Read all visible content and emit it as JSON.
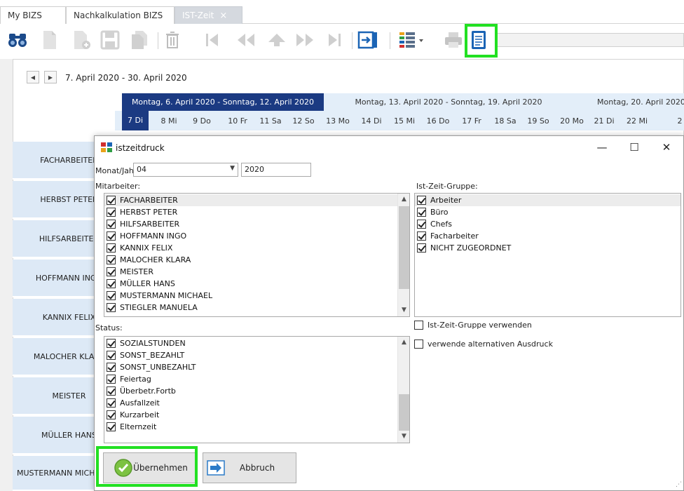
{
  "tabs": [
    {
      "label": "My BIZS"
    },
    {
      "label": "Nachkalkulation BIZS"
    },
    {
      "label": "IST-Zeit",
      "close": "×"
    }
  ],
  "toolbar": {
    "icons": [
      "binoculars-icon",
      "new-document-icon",
      "add-document-icon",
      "save-icon",
      "copy-document-icon",
      "delete-icon",
      "first-record-icon",
      "previous-record-icon",
      "up-icon",
      "next-record-icon",
      "last-record-icon",
      "exit-icon",
      "list-view-icon",
      "print-icon",
      "report-icon"
    ]
  },
  "calendar": {
    "prev": "◀",
    "next": "▶",
    "date_range": "7. April 2020 - 30. April 2020",
    "weeks": [
      "Montag, 6. April 2020 - Sonntag, 12. April 2020",
      "Montag, 13. April 2020 - Sonntag, 19. April 2020",
      "Montag, 20. April 2020"
    ],
    "days": [
      "7 Di",
      "8 Mi",
      "9 Do",
      "10 Fr",
      "11 Sa",
      "12 So",
      "13 Mo",
      "14 Di",
      "15 Mi",
      "16 Do",
      "17 Fr",
      "18 Sa",
      "19 So",
      "20 Mo",
      "21 Di",
      "22 Mi",
      "2"
    ],
    "employees": [
      "FACHARBEITER",
      "HERBST PETER",
      "HILFSARBEITER",
      "HOFFMANN INGO",
      "KANNIX FELIX",
      "MALOCHER KLARA",
      "MEISTER",
      "MÜLLER HANS",
      "MUSTERMANN MICH"
    ]
  },
  "dialog": {
    "title": "istzeitdruck",
    "minimize": "—",
    "maximize": "☐",
    "close": "✕",
    "month_year_label": "Monat/Jahr:",
    "month_value": "04",
    "year_value": "2020",
    "mitarbeiter_label": "Mitarbeiter:",
    "mitarbeiter": [
      "FACHARBEITER",
      "HERBST PETER",
      "HILFSARBEITER",
      "HOFFMANN INGO",
      "KANNIX FELIX",
      "MALOCHER KLARA",
      "MEISTER",
      "MÜLLER HANS",
      "MUSTERMANN MICHAEL",
      "STIEGLER MANUELA"
    ],
    "gruppe_label": "Ist-Zeit-Gruppe:",
    "gruppen": [
      "Arbeiter",
      "Büro",
      "Chefs",
      "Facharbeiter",
      "NICHT ZUGEORDNET"
    ],
    "status_label": "Status:",
    "status": [
      "SOZIALSTUNDEN",
      "SONST_BEZAHLT",
      "SONST_UNBEZAHLT",
      "Feiertag",
      "Überbetr.Fortb",
      "Ausfallzeit",
      "Kurzarbeit",
      "Elternzeit"
    ],
    "opt_gruppe": "Ist-Zeit-Gruppe verwenden",
    "opt_alt": "verwende alternativen Ausdruck",
    "ok_label": "Übernehmen",
    "cancel_label": "Abbruch"
  },
  "colors": {
    "highlight": "#22e022",
    "selected_week": "#1b3a82",
    "band": "#e3eef9",
    "row": "#dde9f6"
  }
}
